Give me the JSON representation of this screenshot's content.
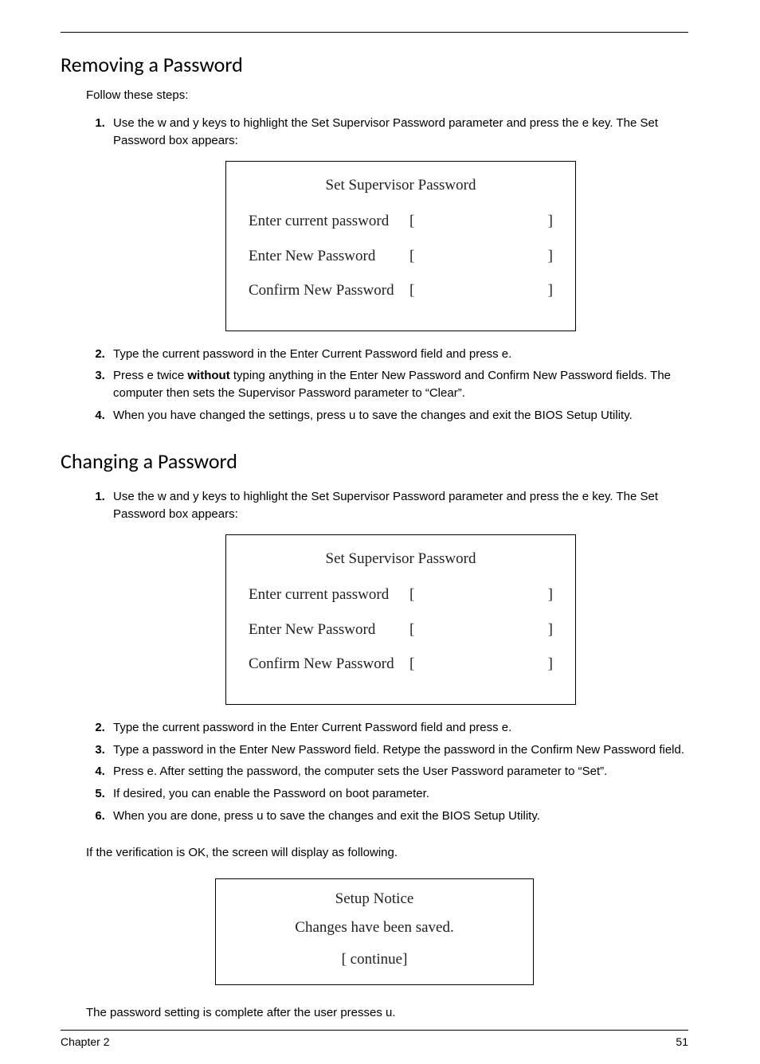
{
  "sections": {
    "removing": {
      "heading": "Removing a Password",
      "lead": "Follow these steps:",
      "steps": {
        "s1_a": "Use the ",
        "s1_k1": "w",
        "s1_b": " and ",
        "s1_k2": "y",
        "s1_c": " keys to highlight the Set Supervisor Password parameter and press the ",
        "s1_k3": "e",
        "s1_d": " key. The Set Password box appears:",
        "s2_a": "Type the current password in the Enter Current Password field and press ",
        "s2_k1": "e",
        "s2_b": ".",
        "s3_a": "Press ",
        "s3_k1": "e",
        "s3_b": " twice ",
        "s3_bold": "without",
        "s3_c": " typing anything in the Enter New Password and Confirm New Password fields. The computer then sets the Supervisor Password parameter to “Clear”.",
        "s4_a": "When you have changed the settings, press ",
        "s4_k1": "u",
        "s4_b": " to save the changes and exit the BIOS Setup Utility."
      }
    },
    "changing": {
      "heading": "Changing a Password",
      "steps": {
        "s1_a": "Use the ",
        "s1_k1": "w",
        "s1_b": " and ",
        "s1_k2": "y",
        "s1_c": " keys to highlight the Set Supervisor Password parameter and press the ",
        "s1_k3": "e",
        "s1_d": " key. The Set Password box appears:",
        "s2_a": "Type the current password in the Enter Current Password field and press ",
        "s2_k1": "e",
        "s2_b": ".",
        "s3": "Type a password in the Enter New Password field. Retype the password in the Confirm New Password field.",
        "s4_a": "Press ",
        "s4_k1": "e",
        "s4_b": ". After setting the password, the computer sets the User Password parameter to “Set”.",
        "s5": "If desired, you can enable the Password on boot parameter.",
        "s6_a": "When you are done, press ",
        "s6_k1": "u",
        "s6_b": " to save the changes and exit the BIOS Setup Utility."
      }
    }
  },
  "dialog": {
    "title": "Set Supervisor Password",
    "rows": {
      "current": "Enter current password",
      "new": "Enter New Password",
      "confirm": "Confirm New Password"
    }
  },
  "verification_para": "If the verification is OK, the screen will display as following.",
  "notice": {
    "title": "Setup Notice",
    "message": "Changes have been saved.",
    "button": "[ continue]"
  },
  "closing_a": "The password setting is complete after the user presses ",
  "closing_k": "u",
  "closing_b": ".",
  "footer": {
    "left": "Chapter 2",
    "right": "51"
  }
}
